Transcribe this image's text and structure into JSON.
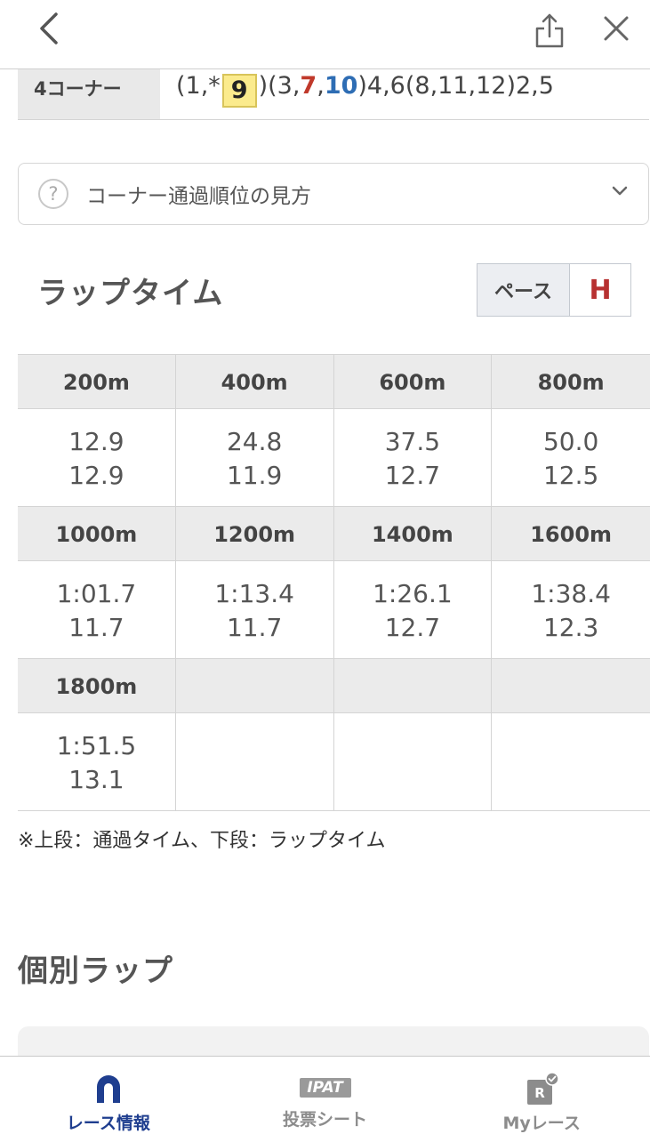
{
  "corner": {
    "label": "4コーナー",
    "parts": {
      "p1": "(1,*",
      "highlight": "9",
      "p2": ")(3,",
      "red": "7",
      "comma": ",",
      "blue": "10",
      "p3": ")4,6(8,11,12)2,5"
    }
  },
  "help": {
    "icon_char": "?",
    "label": "コーナー通過順位の見方"
  },
  "lap": {
    "title": "ラップタイム",
    "pace_label": "ペース",
    "pace_value": "H",
    "rows": [
      {
        "heads": [
          "200m",
          "400m",
          "600m",
          "800m"
        ],
        "cells": [
          {
            "top": "12.9",
            "bottom": "12.9"
          },
          {
            "top": "24.8",
            "bottom": "11.9"
          },
          {
            "top": "37.5",
            "bottom": "12.7"
          },
          {
            "top": "50.0",
            "bottom": "12.5"
          }
        ]
      },
      {
        "heads": [
          "1000m",
          "1200m",
          "1400m",
          "1600m"
        ],
        "cells": [
          {
            "top": "1:01.7",
            "bottom": "11.7"
          },
          {
            "top": "1:13.4",
            "bottom": "11.7"
          },
          {
            "top": "1:26.1",
            "bottom": "12.7"
          },
          {
            "top": "1:38.4",
            "bottom": "12.3"
          }
        ]
      },
      {
        "heads": [
          "1800m",
          "",
          "",
          ""
        ],
        "cells": [
          {
            "top": "1:51.5",
            "bottom": "13.1"
          },
          {
            "top": "",
            "bottom": ""
          },
          {
            "top": "",
            "bottom": ""
          },
          {
            "top": "",
            "bottom": ""
          }
        ]
      }
    ],
    "note": "※上段：通過タイム、下段：ラップタイム"
  },
  "individual": {
    "title": "個別ラップ"
  },
  "tabs": [
    {
      "label": "レース情報",
      "icon": "horseshoe-icon",
      "active": true
    },
    {
      "label": "投票シート",
      "icon": "ipat-icon",
      "badge": "IPAT",
      "active": false
    },
    {
      "label": "Myレース",
      "icon": "my-race-icon",
      "badge": "R",
      "active": false
    }
  ],
  "colors": {
    "accent": "#1f3e8f",
    "pace_high": "#b73131",
    "highlight": "#fbeb8d",
    "red_number": "#c0392b",
    "blue_number": "#2e6db4"
  }
}
